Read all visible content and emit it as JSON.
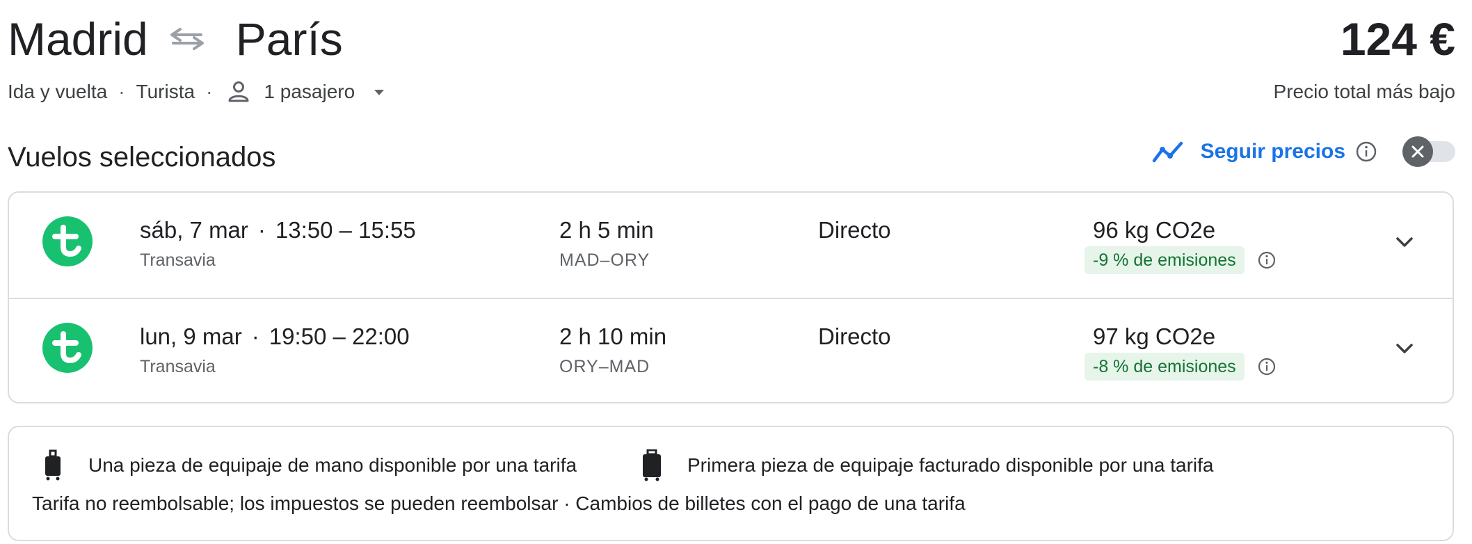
{
  "header": {
    "origin": "Madrid",
    "destination": "París",
    "swap_icon": "swap-arrows-icon",
    "price": "124 €",
    "price_label": "Precio total más bajo"
  },
  "trip_options": {
    "trip_type": "Ida y vuelta",
    "cabin": "Turista",
    "passengers": "1 pasajero",
    "separator": "·",
    "person_icon": "person-icon",
    "caret_icon": "caret-down-icon"
  },
  "section": {
    "title": "Vuelos seleccionados"
  },
  "price_tracking": {
    "label": "Seguir precios",
    "toggle_state": "off",
    "accent_color": "#1a73e8"
  },
  "flights": [
    {
      "date": "sáb, 7 mar",
      "times": "13:50 – 15:55",
      "airline": "Transavia",
      "duration": "2 h 5 min",
      "route": "MAD–ORY",
      "stops": "Directo",
      "co2": "96 kg CO2e",
      "emissions_badge": "-9 % de emisiones"
    },
    {
      "date": "lun, 9 mar",
      "times": "19:50 – 22:00",
      "airline": "Transavia",
      "duration": "2 h 10 min",
      "route": "ORY–MAD",
      "stops": "Directo",
      "co2": "97 kg CO2e",
      "emissions_badge": "-8 % de emisiones"
    }
  ],
  "baggage": {
    "carry_on": "Una pieza de equipaje de mano disponible por una tarifa",
    "checked": "Primera pieza de equipaje facturado disponible por una tarifa",
    "fare_note": "Tarifa no reembolsable; los impuestos se pueden reembolsar · Cambios de billetes con el pago de una tarifa"
  },
  "colors": {
    "airline_logo": "#18c16f",
    "emissions_bg": "#e6f4ea",
    "emissions_text": "#137333",
    "border": "#dadce0"
  }
}
